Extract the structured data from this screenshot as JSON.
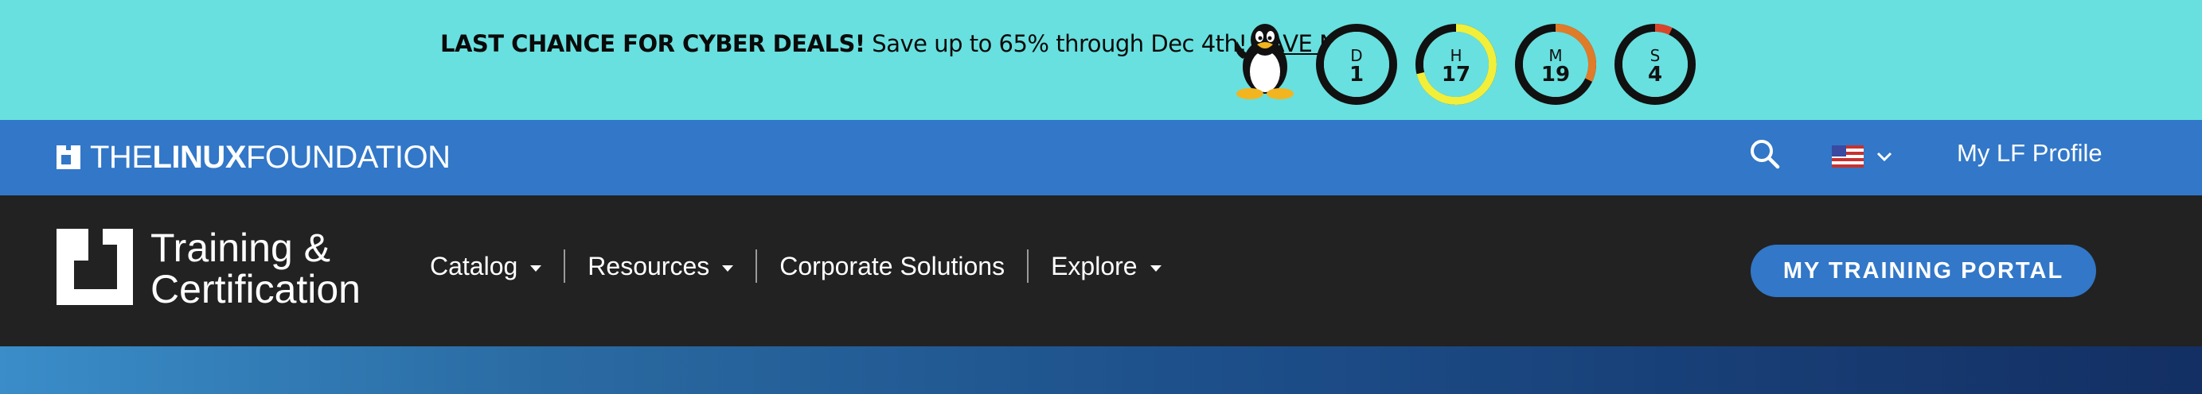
{
  "promo": {
    "headline": "LAST CHANCE FOR CYBER DEALS!",
    "message": " Save up to 65% through Dec 4th! ",
    "cta": "SAVE NOW",
    "period": ".",
    "countdown": [
      {
        "unit": "D",
        "value": "1",
        "ring_color": "#111111",
        "progress": 0.0
      },
      {
        "unit": "H",
        "value": "17",
        "ring_color": "#f2ef3a",
        "progress": 0.71
      },
      {
        "unit": "M",
        "value": "19",
        "ring_color": "#e07b2a",
        "progress": 0.32
      },
      {
        "unit": "S",
        "value": "4",
        "ring_color": "#d9452b",
        "progress": 0.07
      }
    ]
  },
  "lfbar": {
    "logo_the": "THE",
    "logo_linux": "LINUX",
    "logo_foundation": "FOUNDATION",
    "profile": "My LF Profile",
    "bg_color": "#3277c8"
  },
  "training": {
    "logo_title": "Training &\nCertification",
    "nav": [
      {
        "label": "Catalog",
        "has_dropdown": true
      },
      {
        "label": "Resources",
        "has_dropdown": true
      },
      {
        "label": "Corporate Solutions",
        "has_dropdown": false
      },
      {
        "label": "Explore",
        "has_dropdown": true
      }
    ],
    "portal_button": "MY TRAINING PORTAL"
  }
}
